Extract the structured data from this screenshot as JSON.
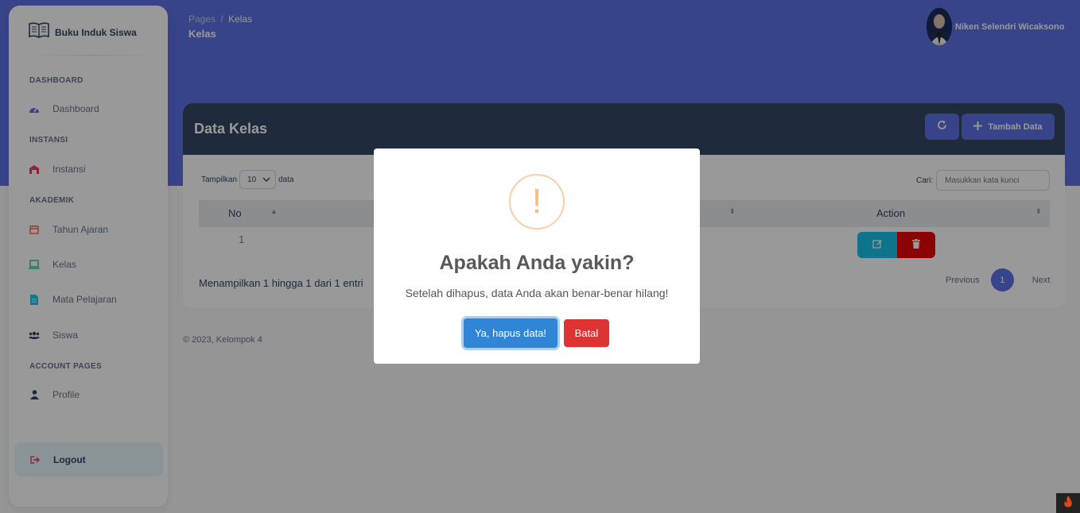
{
  "brand": {
    "name": "Buku Induk Siswa"
  },
  "sidebar": {
    "sections": {
      "dashboard": "DASHBOARD",
      "instansi": "INSTANSI",
      "akademik": "AKADEMIK",
      "account": "ACCOUNT PAGES"
    },
    "items": [
      {
        "label": "Dashboard",
        "icon": "dashboard-icon"
      },
      {
        "label": "Instansi",
        "icon": "building-icon"
      },
      {
        "label": "Tahun Ajaran",
        "icon": "calendar-icon"
      },
      {
        "label": "Kelas",
        "icon": "laptop-icon"
      },
      {
        "label": "Mata Pelajaran",
        "icon": "document-icon"
      },
      {
        "label": "Siswa",
        "icon": "users-icon"
      },
      {
        "label": "Profile",
        "icon": "user-icon"
      }
    ],
    "logout": "Logout"
  },
  "header": {
    "breadcrumb_root": "Pages",
    "breadcrumb_sep": "/",
    "breadcrumb_current": "Kelas",
    "title": "Kelas",
    "user_name": "Niken Selendri Wicaksono"
  },
  "card": {
    "title": "Data Kelas",
    "add_label": "Tambah Data",
    "length_prefix": "Tampilkan",
    "length_value": "10",
    "length_suffix": "data",
    "search_label": "Cari:",
    "search_placeholder": "Masukkan kata kunci",
    "columns": {
      "no": "No",
      "action": "Action"
    },
    "rows": [
      {
        "no": "1"
      }
    ],
    "info": "Menampilkan 1 hingga 1 dari 1 entri",
    "pagination": {
      "previous": "Previous",
      "current": "1",
      "next": "Next"
    }
  },
  "footer": {
    "text": "© 2023, Kelompok 4"
  },
  "modal": {
    "icon_glyph": "!",
    "title": "Apakah Anda yakin?",
    "text": "Setelah dihapus, data Anda akan benar-benar hilang!",
    "confirm": "Ya, hapus data!",
    "cancel": "Batal"
  },
  "colors": {
    "primary": "#5e72e4",
    "dark": "#344767",
    "info": "#17c1e8",
    "danger": "#ea0606",
    "confirm": "#3085d6",
    "cancel": "#dd3333"
  }
}
